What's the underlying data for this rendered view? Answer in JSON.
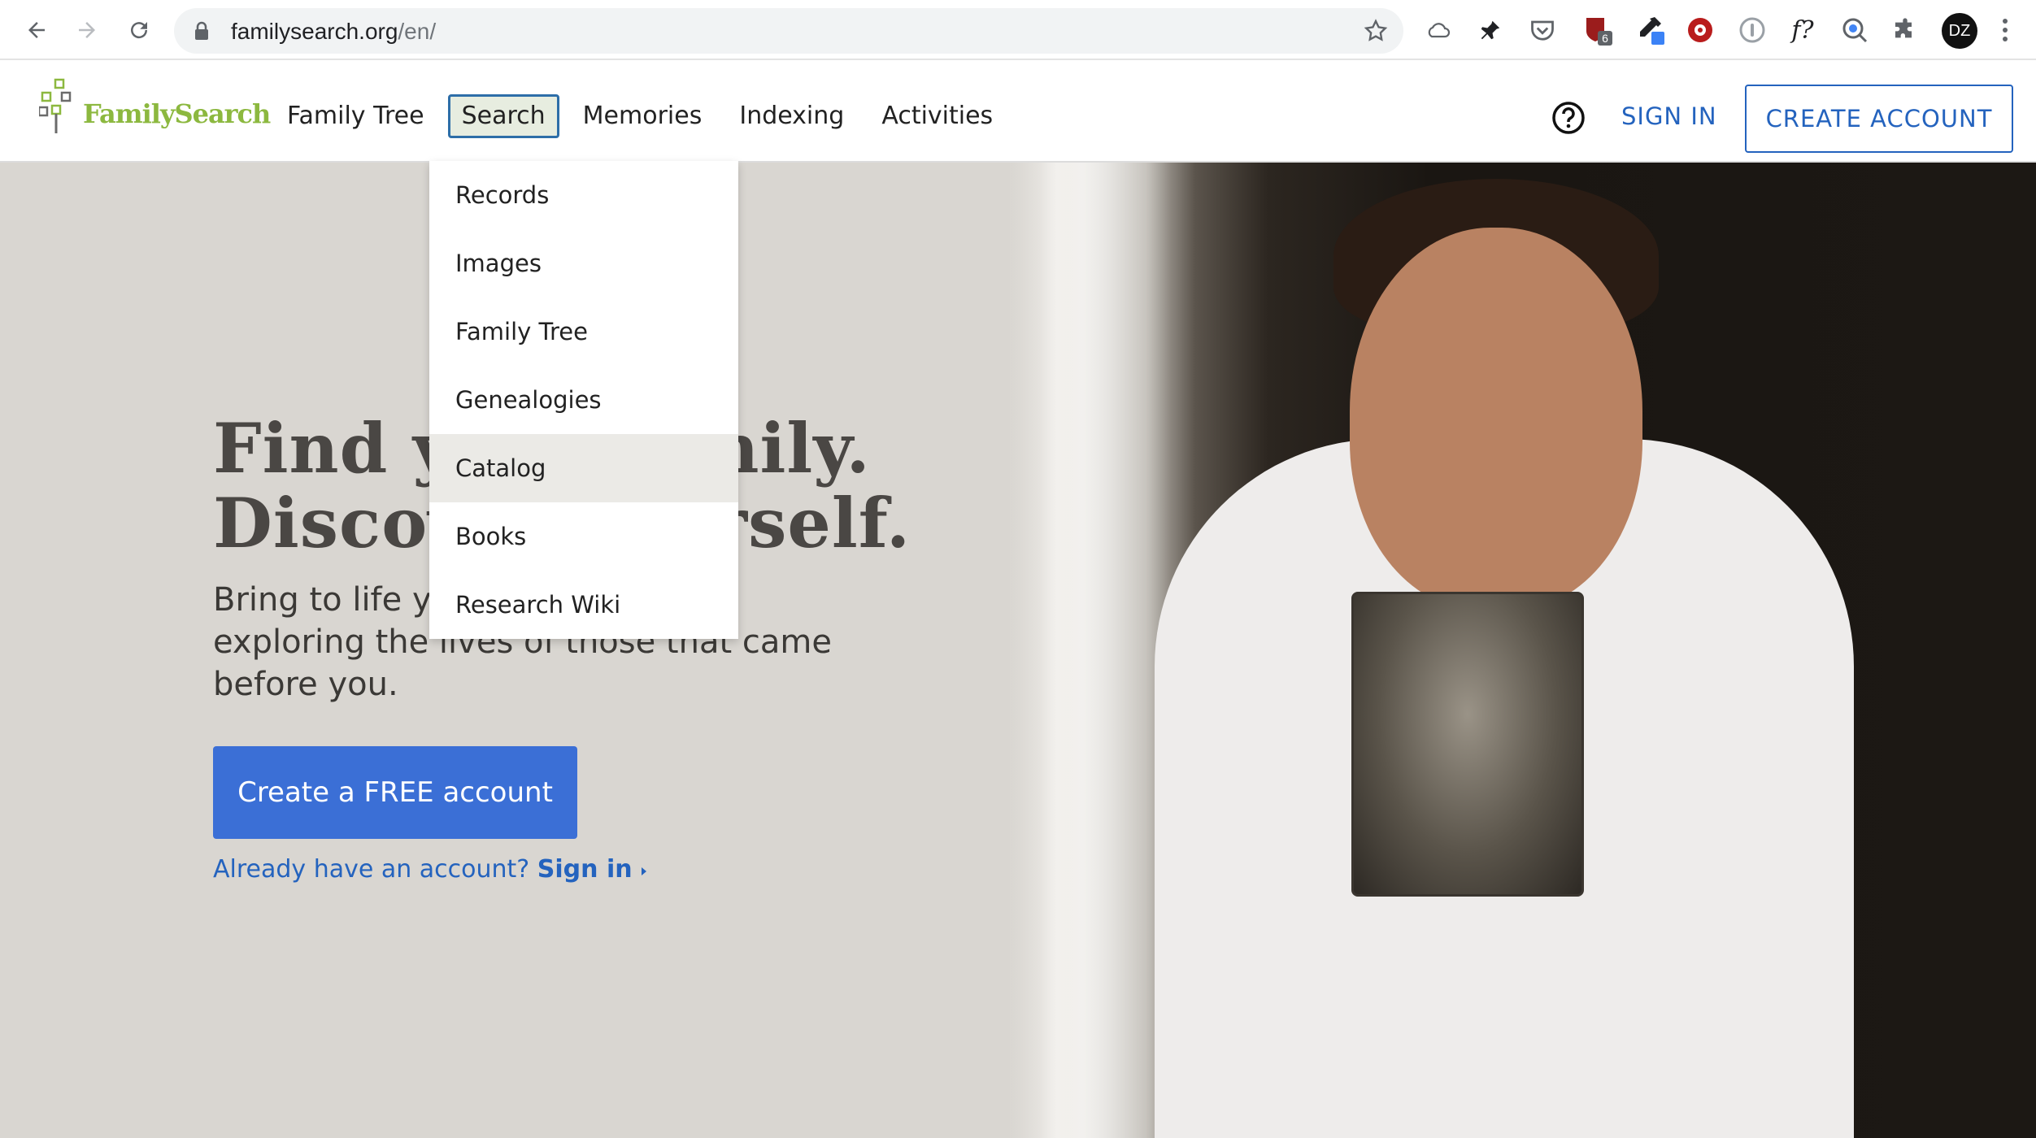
{
  "browser": {
    "url_host": "familysearch.org",
    "url_path": "/en/",
    "extension_badge": "6",
    "profile_initials": "DZ"
  },
  "header": {
    "logo_text": "FamilySearch",
    "nav": [
      "Family Tree",
      "Search",
      "Memories",
      "Indexing",
      "Activities"
    ],
    "active_nav": "Search",
    "sign_in": "SIGN IN",
    "create_account": "CREATE ACCOUNT"
  },
  "dropdown": {
    "items": [
      "Records",
      "Images",
      "Family Tree",
      "Genealogies",
      "Catalog",
      "Books",
      "Research Wiki"
    ],
    "hovered": "Catalog"
  },
  "hero": {
    "headline_line1": "Find your family.",
    "headline_line2": "Discover yourself.",
    "subtext": "Bring to life your family story by exploring the lives of those that came before you.",
    "cta": "Create a FREE account",
    "signin_prompt": "Already have an account?",
    "signin_link": "Sign in"
  },
  "colors": {
    "brand_green": "#8cb83f",
    "link_blue": "#2463be",
    "cta_blue": "#3b6fd6"
  }
}
